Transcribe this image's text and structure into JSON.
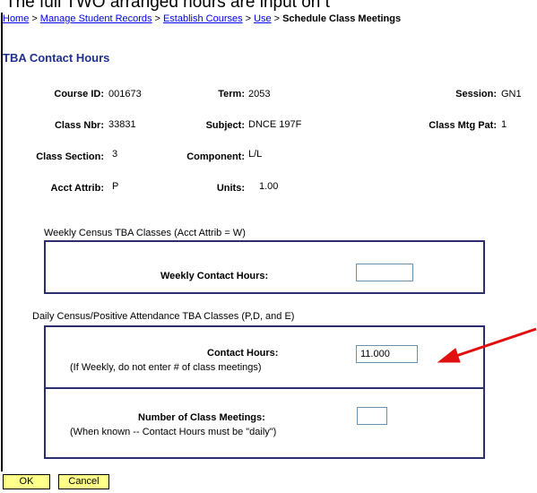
{
  "caption": "The full TWO arranged hours are input on t",
  "breadcrumb": {
    "items": [
      "Home",
      "Manage Student Records",
      "Establish Courses",
      "Use"
    ],
    "separator": ">",
    "current": "Schedule Class Meetings"
  },
  "page_title": "TBA Contact Hours",
  "details": {
    "course_id": {
      "label": "Course ID:",
      "value": "001673"
    },
    "term": {
      "label": "Term:",
      "value": "2053"
    },
    "session": {
      "label": "Session:",
      "value": "GN1"
    },
    "class_nbr": {
      "label": "Class Nbr:",
      "value": "33831"
    },
    "subject": {
      "label": "Subject:",
      "value": "DNCE  197F"
    },
    "class_mtg_pat": {
      "label": "Class Mtg Pat:",
      "value": "1"
    },
    "class_section": {
      "label": "Class Section:",
      "value": "3"
    },
    "component": {
      "label": "Component:",
      "value": "L/L"
    },
    "acct_attrib": {
      "label": "Acct Attrib:",
      "value": "P"
    },
    "units": {
      "label": "Units:",
      "value": "1.00"
    }
  },
  "weekly_group": {
    "caption": "Weekly Census TBA Classes (Acct Attrib = W)",
    "field_label": "Weekly Contact Hours:",
    "field_value": ""
  },
  "daily_group": {
    "caption": "Daily Census/Positive Attendance TBA Classes (P,D, and E)",
    "contact_label": "Contact Hours:",
    "contact_note": "(If Weekly, do not enter # of class meetings)",
    "contact_value": "11.000",
    "meetings_label": "Number of Class Meetings:",
    "meetings_note": "(When known -- Contact Hours must be \"daily\")",
    "meetings_value": ""
  },
  "buttons": {
    "ok": "OK",
    "cancel": "Cancel"
  },
  "colors": {
    "title": "#1f2f8f",
    "link": "#0000ee",
    "box_border": "#2d2d70",
    "button_bg": "#ffff8a",
    "arrow": "#e01010"
  }
}
